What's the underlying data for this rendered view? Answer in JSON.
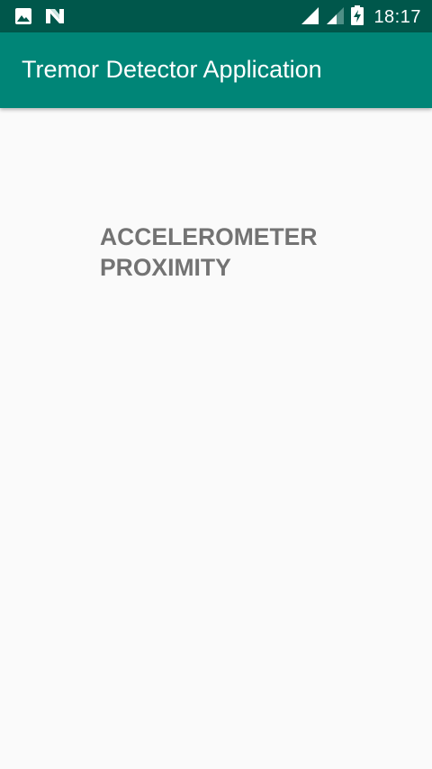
{
  "status_bar": {
    "left_icons": [
      "image-icon",
      "n-logo-icon"
    ],
    "right_icons": [
      "signal-icon",
      "signal-weak-icon",
      "battery-charging-icon"
    ],
    "time": "18:17"
  },
  "app_bar": {
    "title": "Tremor Detector Application"
  },
  "main": {
    "sensors": [
      "ACCELEROMETER",
      "PROXIMITY"
    ]
  },
  "colors": {
    "status_bar": "#00574b",
    "app_bar": "#008577",
    "background": "#fafafa",
    "sensor_text": "#737373"
  }
}
